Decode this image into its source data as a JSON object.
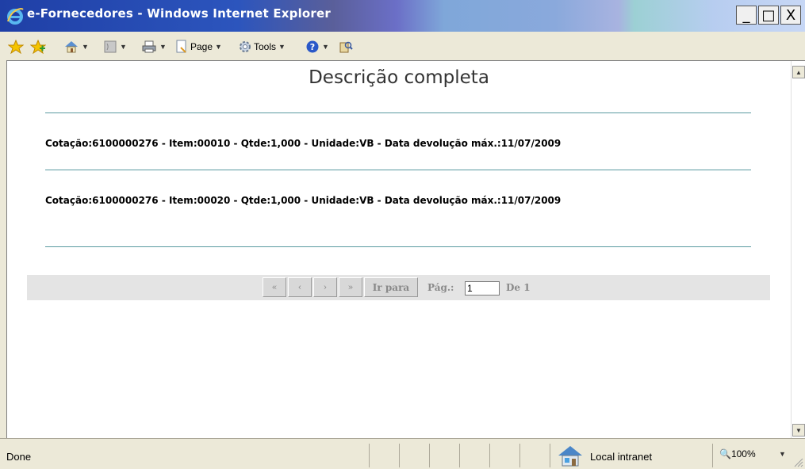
{
  "window": {
    "title": "e-Fornecedores - Windows Internet Explorer",
    "min_glyph": "_",
    "max_glyph": "□",
    "close_glyph": "X"
  },
  "toolbar": {
    "page_label": "Page",
    "page_accel": "P",
    "tools_label": "Tools",
    "tools_accel": "o",
    "icons": [
      "favorites-star-icon",
      "add-favorites-icon",
      "home-icon",
      "feeds-icon",
      "print-icon",
      "page-icon",
      "tools-gear-icon",
      "help-icon",
      "research-icon"
    ]
  },
  "content": {
    "title": "Descrição completa",
    "items": [
      "Cotação:6100000276 - Item:00010 - Qtde:1,000 - Unidade:VB - Data devolução máx.:11/07/2009",
      "Cotação:6100000276 - Item:00020 - Qtde:1,000 - Unidade:VB - Data devolução máx.:11/07/2009"
    ],
    "pager": {
      "first": "«",
      "prev": "‹",
      "next": "›",
      "last": "»",
      "goto_label": "Ir para",
      "page_label": "Pág.:",
      "page_value": "1",
      "total_label": "De 1"
    }
  },
  "status": {
    "text": "Done",
    "zone": "Local intranet",
    "zoom": "100%"
  },
  "colors": {
    "accent_line": "#5a9aa0",
    "titlebar": "#2c55bd"
  }
}
